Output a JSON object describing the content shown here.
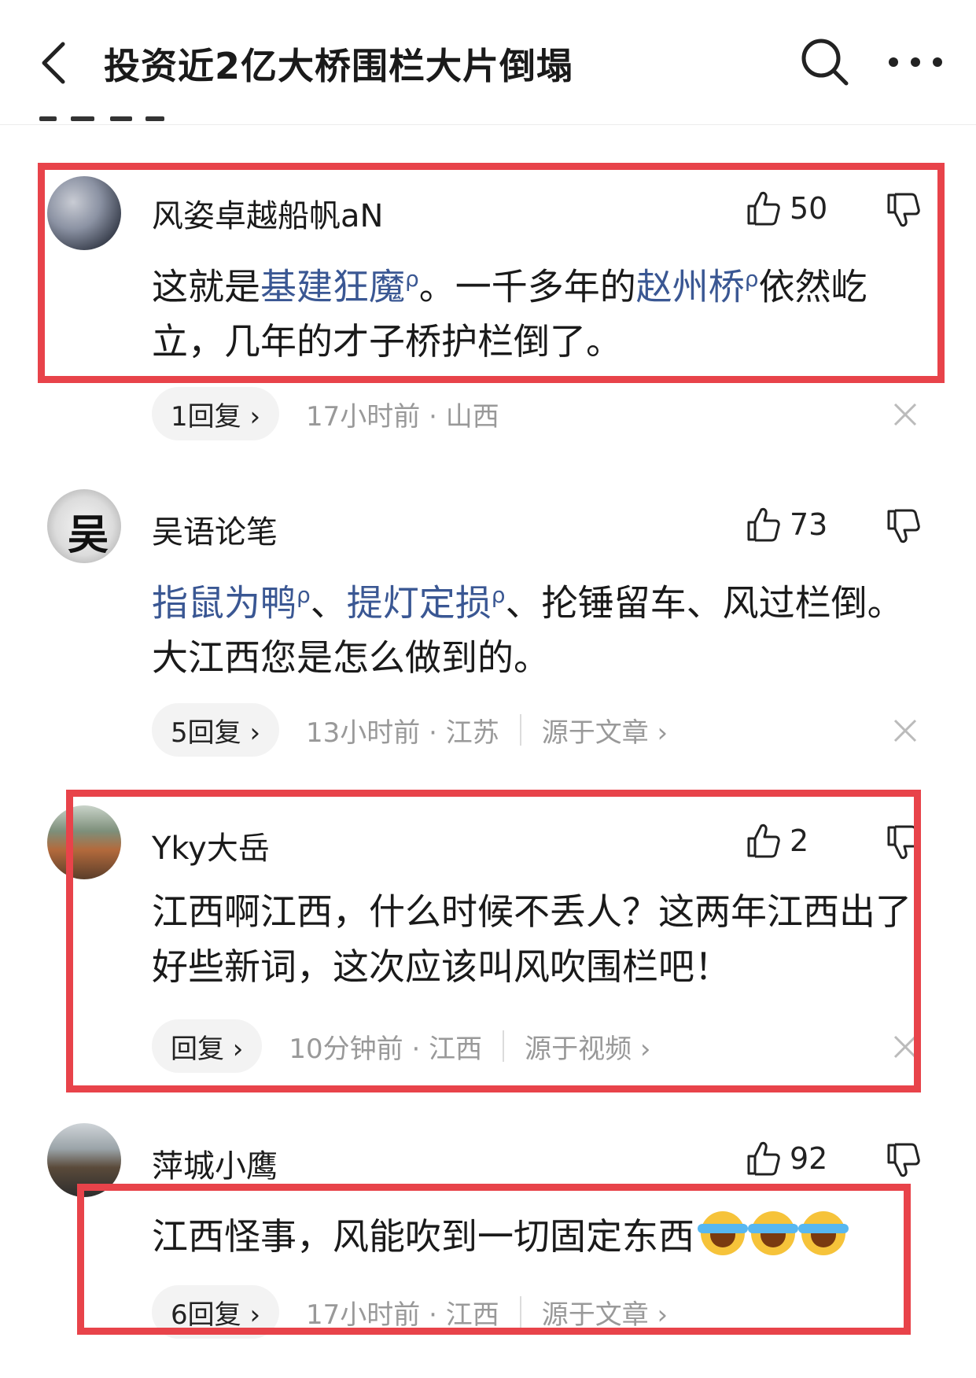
{
  "header": {
    "title": "投资近2亿大桥围栏大片倒塌"
  },
  "comments": [
    {
      "user": "风姿卓越船帆aN",
      "likes": "50",
      "text": [
        "这就是",
        "基建狂魔",
        "。一千多年的",
        "赵州桥",
        "依然屹立，几年的才子桥护栏倒了。"
      ],
      "replies": "1回复 ›",
      "time": "17小时前 · 山西",
      "source": ""
    },
    {
      "user": "吴语论笔",
      "likes": "73",
      "text": [
        "指鼠为鸭",
        "、",
        "提灯定损",
        "、抡锤留车、风过栏倒。大江西您是怎么做到的。"
      ],
      "replies": "5回复 ›",
      "time": "13小时前 · 江苏",
      "source": "源于文章 ›"
    },
    {
      "user": "Yky大岳",
      "likes": "2",
      "text": "江西啊江西，什么时候不丢人？这两年江西出了好些新词，这次应该叫风吹围栏吧！",
      "replies": "回复 ›",
      "time": "10分钟前 · 江西",
      "source": "源于视频 ›"
    },
    {
      "user": "萍城小鹰",
      "likes": "92",
      "text": "江西怪事，风能吹到一切固定东西",
      "emoji": "loudly-crying-face",
      "replies": "6回复 ›",
      "time": "17小时前 · 江西",
      "source": "源于文章 ›"
    }
  ],
  "colors": {
    "highlight": "#e8434a",
    "keyword": "#3a5793",
    "meta": "#999999"
  }
}
